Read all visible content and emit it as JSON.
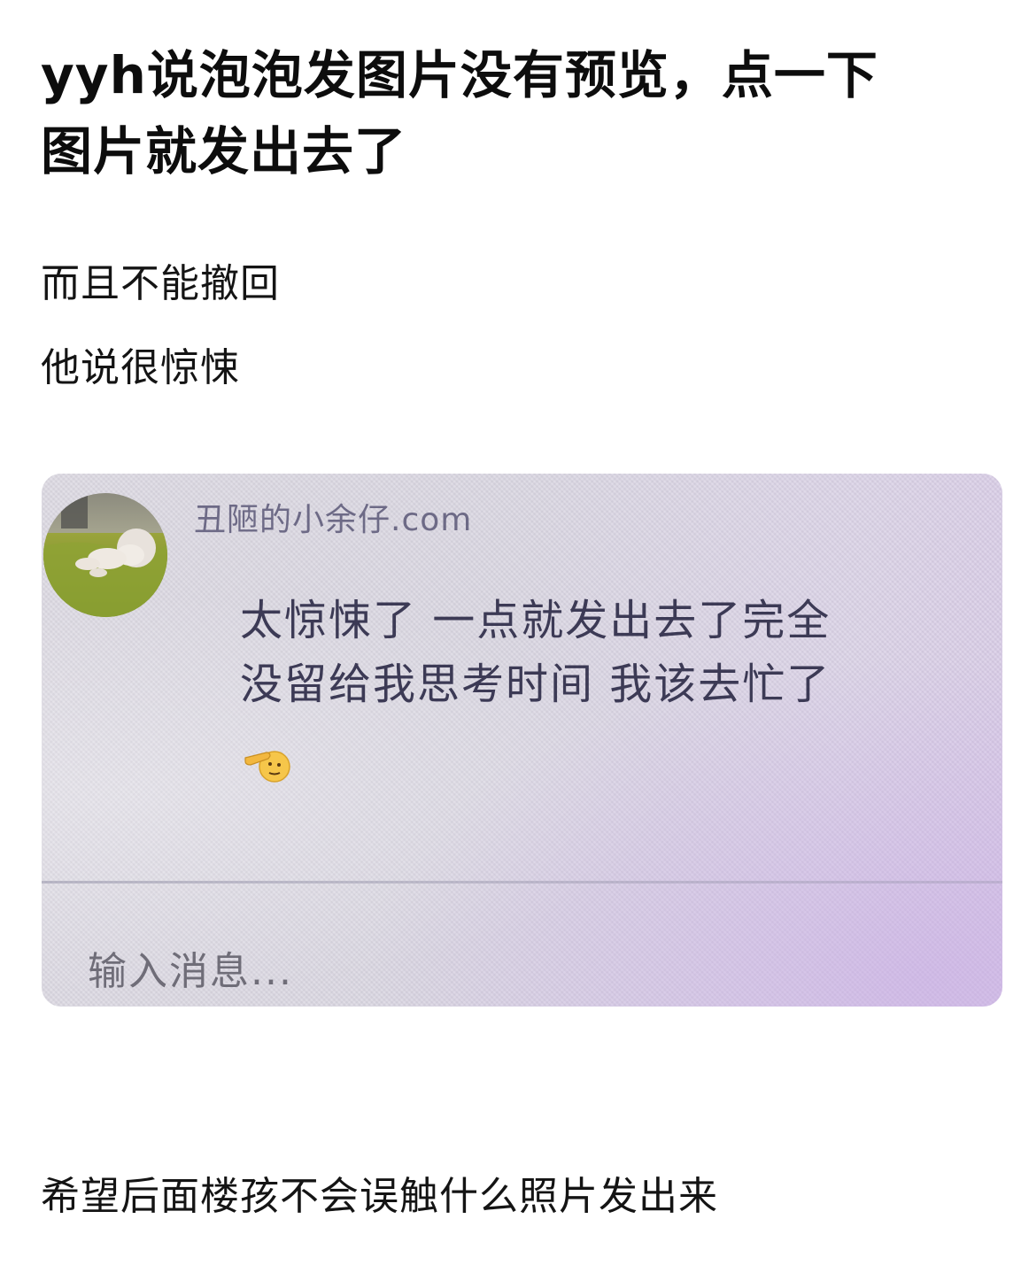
{
  "post": {
    "title_lines": [
      "yyh说泡泡发图片没有预览，点一下",
      "图片就发出去了"
    ],
    "paragraphs": [
      "而且不能撤回",
      "他说很惊悚"
    ],
    "closing": "希望后面楼孩不会误触什么照片发出来"
  },
  "chat_screenshot": {
    "sender_name": "丑陋的小余仔.com",
    "message_lines": [
      "太惊悚了 一点就发出去了完全",
      "没留给我思考时间 我该去忙了"
    ],
    "message_emoji": "saluting-face-emoji",
    "input_placeholder": "输入消息...",
    "avatar": "baby-lying-on-grass-photo",
    "colors": {
      "background": "#dad7e2",
      "message_text": "#3c3a55",
      "sender_text": "#6d6a86",
      "placeholder_text": "#6f6d78"
    }
  }
}
